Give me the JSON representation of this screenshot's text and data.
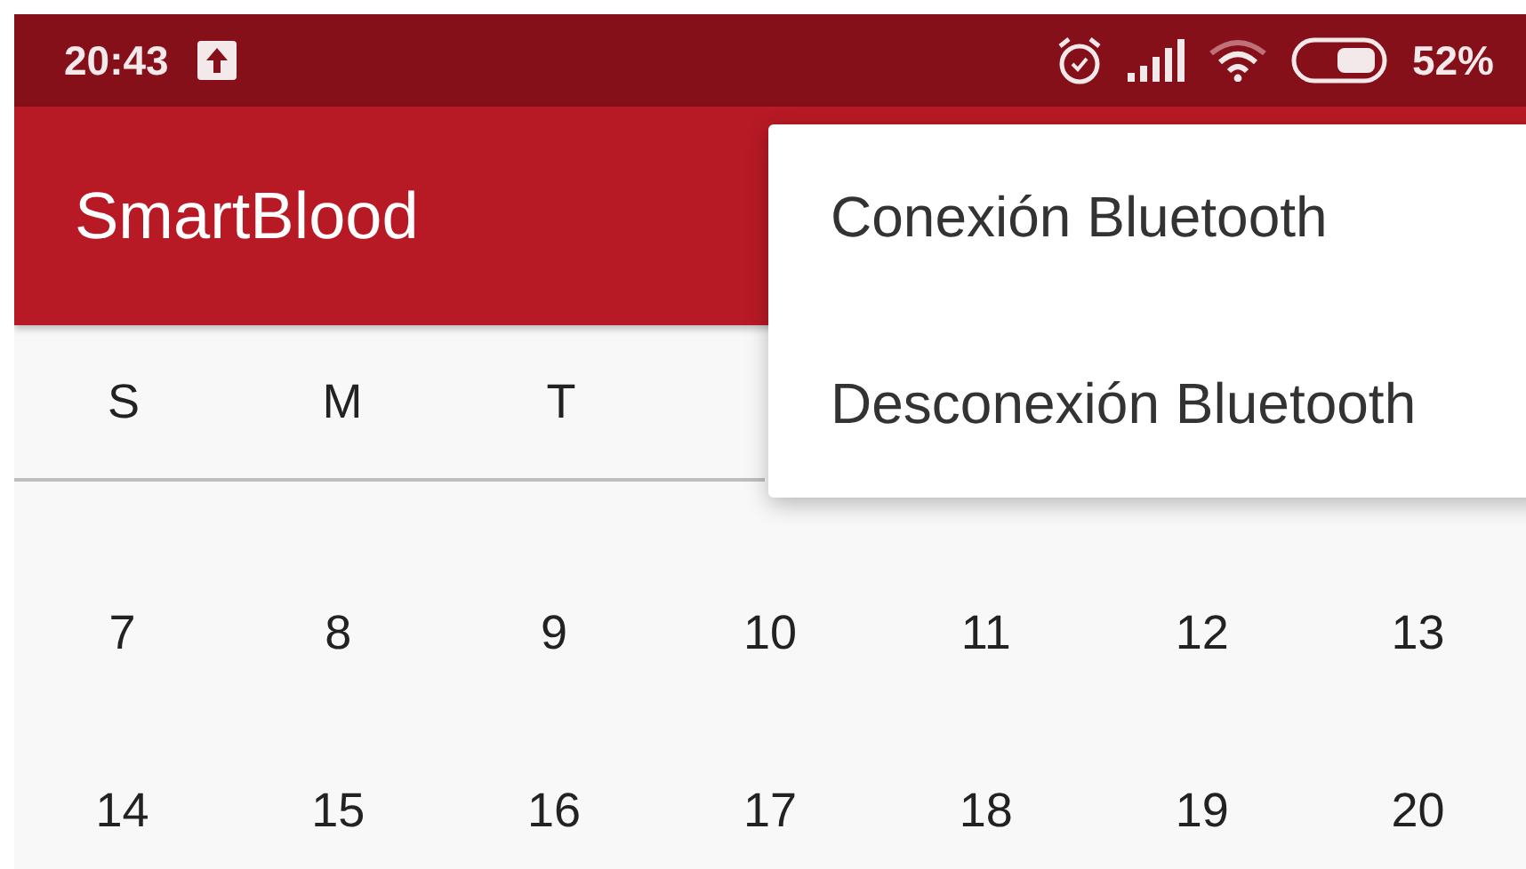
{
  "status_bar": {
    "time": "20:43",
    "battery": "52%"
  },
  "app_bar": {
    "title": "SmartBlood"
  },
  "calendar": {
    "weekdays": [
      "S",
      "M",
      "T"
    ],
    "weeks": [
      [
        "7",
        "8",
        "9",
        "10",
        "11",
        "12",
        "13"
      ],
      [
        "14",
        "15",
        "16",
        "17",
        "18",
        "19",
        "20"
      ]
    ]
  },
  "menu": {
    "items": [
      "Conexión Bluetooth",
      "Desconexión Bluetooth"
    ]
  }
}
